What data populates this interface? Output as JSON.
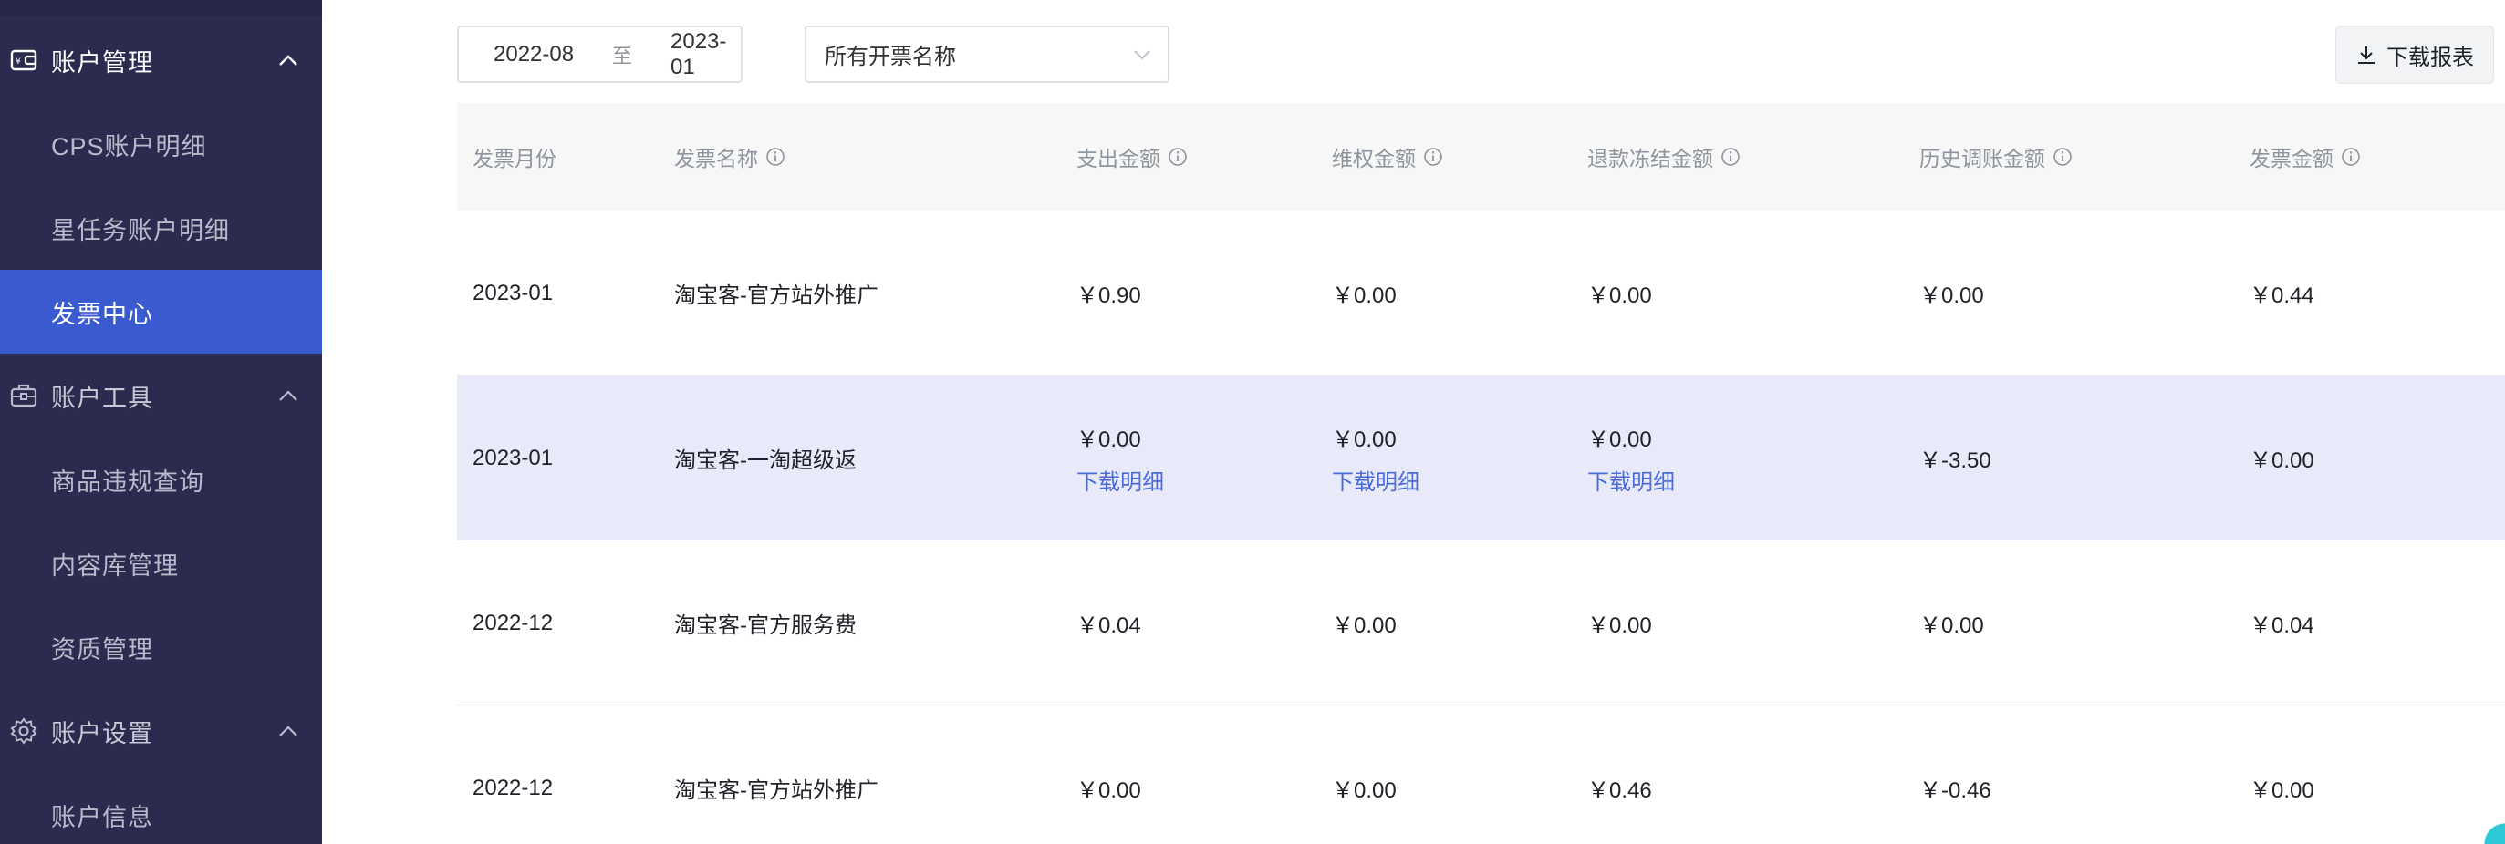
{
  "sidebar": {
    "groups": [
      {
        "label": "账户管理",
        "icon": "wallet-icon",
        "items": [
          "CPS账户明细",
          "星任务账户明细",
          "发票中心"
        ]
      },
      {
        "label": "账户工具",
        "icon": "toolbox-icon",
        "items": [
          "商品违规查询",
          "内容库管理",
          "资质管理"
        ]
      },
      {
        "label": "账户设置",
        "icon": "gear-icon",
        "items": [
          "账户信息"
        ]
      }
    ],
    "active_item": "发票中心",
    "colors": {
      "bg": "#2b2b4f",
      "active": "#3a5bd0"
    }
  },
  "filters": {
    "date_start": "2022-08",
    "date_sep": "至",
    "date_end": "2023-01",
    "name_select": "所有开票名称"
  },
  "toolbar": {
    "download_label": "下载报表"
  },
  "table": {
    "headers": [
      "发票月份",
      "发票名称",
      "支出金额",
      "维权金额",
      "退款冻结金额",
      "历史调账金额",
      "发票金额"
    ],
    "rows": [
      {
        "month": "2023-01",
        "name": "淘宝客-官方站外推广",
        "expense": "￥0.90",
        "rights": "￥0.00",
        "frozen": "￥0.00",
        "adjust": "￥0.00",
        "invoice": "￥0.44",
        "highlight": false
      },
      {
        "month": "2023-01",
        "name": "淘宝客-一淘超级返",
        "expense": "￥0.00",
        "rights": "￥0.00",
        "frozen": "￥0.00",
        "adjust": "￥-3.50",
        "invoice": "￥0.00",
        "highlight": true,
        "link_label": "下载明细"
      },
      {
        "month": "2022-12",
        "name": "淘宝客-官方服务费",
        "expense": "￥0.04",
        "rights": "￥0.00",
        "frozen": "￥0.00",
        "adjust": "￥0.00",
        "invoice": "￥0.04",
        "highlight": false
      },
      {
        "month": "2022-12",
        "name": "淘宝客-官方站外推广",
        "expense": "￥0.00",
        "rights": "￥0.00",
        "frozen": "￥0.46",
        "adjust": "￥-0.46",
        "invoice": "￥0.00",
        "highlight": false
      }
    ]
  }
}
